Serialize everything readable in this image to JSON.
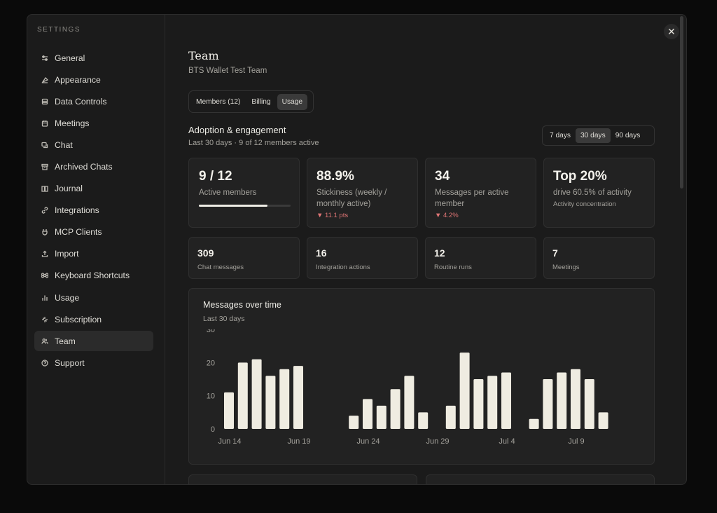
{
  "sidebar": {
    "title": "SETTINGS",
    "items": [
      {
        "label": "General",
        "icon": "sliders-icon"
      },
      {
        "label": "Appearance",
        "icon": "palette-icon"
      },
      {
        "label": "Data Controls",
        "icon": "database-icon"
      },
      {
        "label": "Meetings",
        "icon": "calendar-icon"
      },
      {
        "label": "Chat",
        "icon": "chat-icon"
      },
      {
        "label": "Archived Chats",
        "icon": "archive-icon"
      },
      {
        "label": "Journal",
        "icon": "book-icon"
      },
      {
        "label": "Integrations",
        "icon": "link-icon"
      },
      {
        "label": "MCP Clients",
        "icon": "plug-icon"
      },
      {
        "label": "Import",
        "icon": "upload-icon"
      },
      {
        "label": "Keyboard Shortcuts",
        "icon": "command-icon"
      },
      {
        "label": "Usage",
        "icon": "bar-chart-icon"
      },
      {
        "label": "Subscription",
        "icon": "sparkle-icon"
      },
      {
        "label": "Team",
        "icon": "users-icon"
      },
      {
        "label": "Support",
        "icon": "help-icon"
      }
    ],
    "active": "Team"
  },
  "close": "✕",
  "team": {
    "title": "Team",
    "subtitle": "BTS Wallet Test Team",
    "tabs": [
      "Members (12)",
      "Billing",
      "Usage"
    ],
    "active_tab": "Usage"
  },
  "adoption": {
    "title": "Adoption & engagement",
    "subtitle": "Last 30 days · 9 of 12 members active",
    "range": [
      "7 days",
      "30 days",
      "90 days"
    ],
    "active_range": "30 days"
  },
  "kpis": [
    {
      "value": "9 / 12",
      "label": "Active members",
      "progress": 0.75
    },
    {
      "value": "88.9%",
      "label": "Stickiness (weekly / monthly active)",
      "delta": "▼ 11.1 pts"
    },
    {
      "value": "34",
      "label": "Messages per active member",
      "delta": "▼ 4.2%"
    },
    {
      "value": "Top 20%",
      "label": "drive 60.5% of activity",
      "sub": "Activity concentration"
    }
  ],
  "counts": [
    {
      "value": "309",
      "label": "Chat messages"
    },
    {
      "value": "16",
      "label": "Integration actions"
    },
    {
      "value": "12",
      "label": "Routine runs"
    },
    {
      "value": "7",
      "label": "Meetings"
    }
  ],
  "chart": {
    "title": "Messages over time",
    "subtitle": "Last 30 days"
  },
  "chart_data": {
    "type": "bar",
    "categories": [
      "Jun 14",
      "Jun 15",
      "Jun 16",
      "Jun 17",
      "Jun 18",
      "Jun 19",
      "Jun 20",
      "Jun 21",
      "Jun 22",
      "Jun 23",
      "Jun 24",
      "Jun 25",
      "Jun 26",
      "Jun 27",
      "Jun 28",
      "Jun 29",
      "Jun 30",
      "Jul 1",
      "Jul 2",
      "Jul 3",
      "Jul 4",
      "Jul 5",
      "Jul 6",
      "Jul 7",
      "Jul 8",
      "Jul 9",
      "Jul 10",
      "Jul 11",
      "Jul 12",
      "Jul 13"
    ],
    "values": [
      11,
      20,
      21,
      16,
      18,
      19,
      0,
      0,
      0,
      4,
      9,
      7,
      12,
      16,
      5,
      0,
      7,
      23,
      15,
      16,
      17,
      0,
      3,
      15,
      17,
      18,
      15,
      5,
      0,
      0
    ],
    "x_ticks": [
      "Jun 14",
      "Jun 19",
      "Jun 24",
      "Jun 29",
      "Jul 4",
      "Jul 9"
    ],
    "ylim": [
      0,
      30
    ],
    "y_ticks": [
      0,
      10,
      20,
      30
    ],
    "bar_color": "#efece1"
  }
}
